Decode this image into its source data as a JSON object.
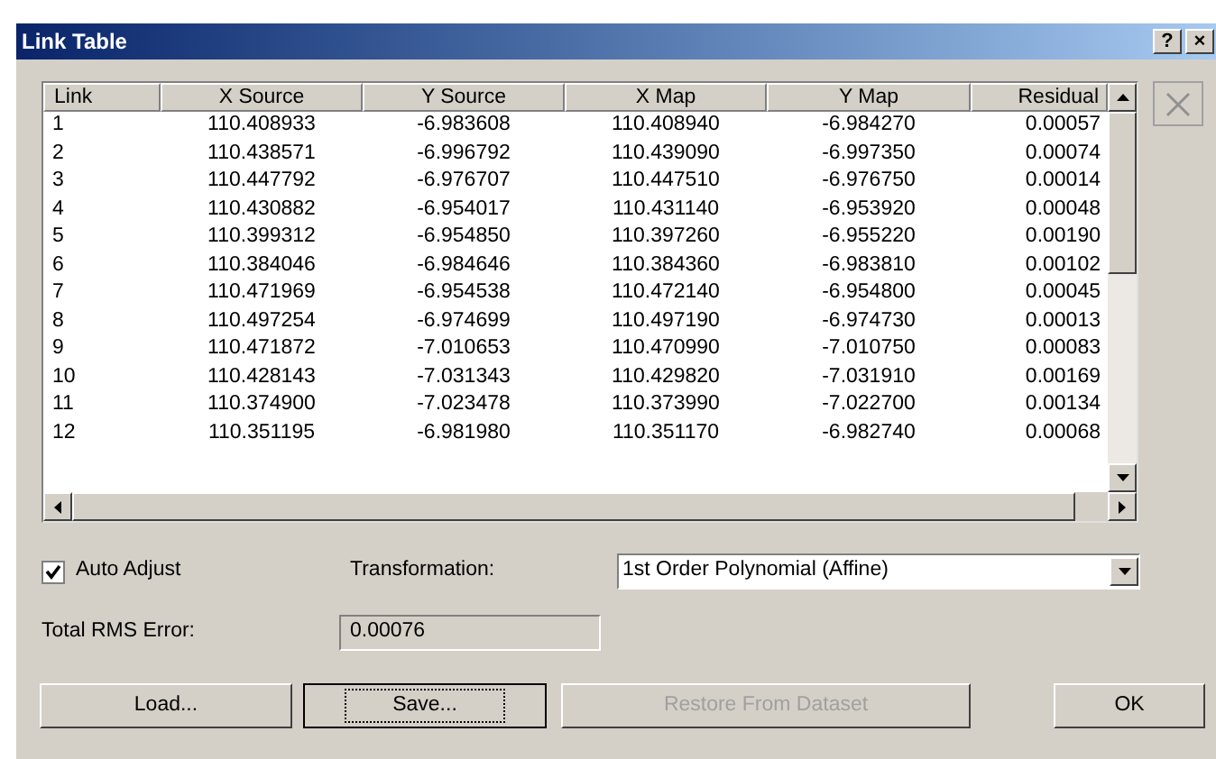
{
  "window": {
    "title": "Link Table",
    "title_buttons": [
      "?",
      "×"
    ]
  },
  "table": {
    "columns": [
      "Link",
      "X Source",
      "Y Source",
      "X Map",
      "Y Map",
      "Residual"
    ],
    "rows": [
      [
        "1",
        "110.408933",
        "-6.983608",
        "110.408940",
        "-6.984270",
        "0.00057"
      ],
      [
        "2",
        "110.438571",
        "-6.996792",
        "110.439090",
        "-6.997350",
        "0.00074"
      ],
      [
        "3",
        "110.447792",
        "-6.976707",
        "110.447510",
        "-6.976750",
        "0.00014"
      ],
      [
        "4",
        "110.430882",
        "-6.954017",
        "110.431140",
        "-6.953920",
        "0.00048"
      ],
      [
        "5",
        "110.399312",
        "-6.954850",
        "110.397260",
        "-6.955220",
        "0.00190"
      ],
      [
        "6",
        "110.384046",
        "-6.984646",
        "110.384360",
        "-6.983810",
        "0.00102"
      ],
      [
        "7",
        "110.471969",
        "-6.954538",
        "110.472140",
        "-6.954800",
        "0.00045"
      ],
      [
        "8",
        "110.497254",
        "-6.974699",
        "110.497190",
        "-6.974730",
        "0.00013"
      ],
      [
        "9",
        "110.471872",
        "-7.010653",
        "110.470990",
        "-7.010750",
        "0.00083"
      ],
      [
        "10",
        "110.428143",
        "-7.031343",
        "110.429820",
        "-7.031910",
        "0.00169"
      ],
      [
        "11",
        "110.374900",
        "-7.023478",
        "110.373990",
        "-7.022700",
        "0.00134"
      ],
      [
        "12",
        "110.351195",
        "-6.981980",
        "110.351170",
        "-6.982740",
        "0.00068"
      ]
    ]
  },
  "auto_adjust": {
    "label": "Auto Adjust",
    "checked": true
  },
  "transformation": {
    "label": "Transformation:",
    "value": "1st Order Polynomial (Affine)"
  },
  "rms": {
    "label": "Total RMS Error:",
    "value": "0.00076"
  },
  "buttons": [
    {
      "label": "Load...",
      "disabled": false,
      "focused": false
    },
    {
      "label": "Save...",
      "disabled": false,
      "focused": true
    },
    {
      "label": "Restore From Dataset",
      "disabled": true,
      "focused": false
    },
    {
      "label": "OK",
      "disabled": false,
      "focused": false
    }
  ]
}
